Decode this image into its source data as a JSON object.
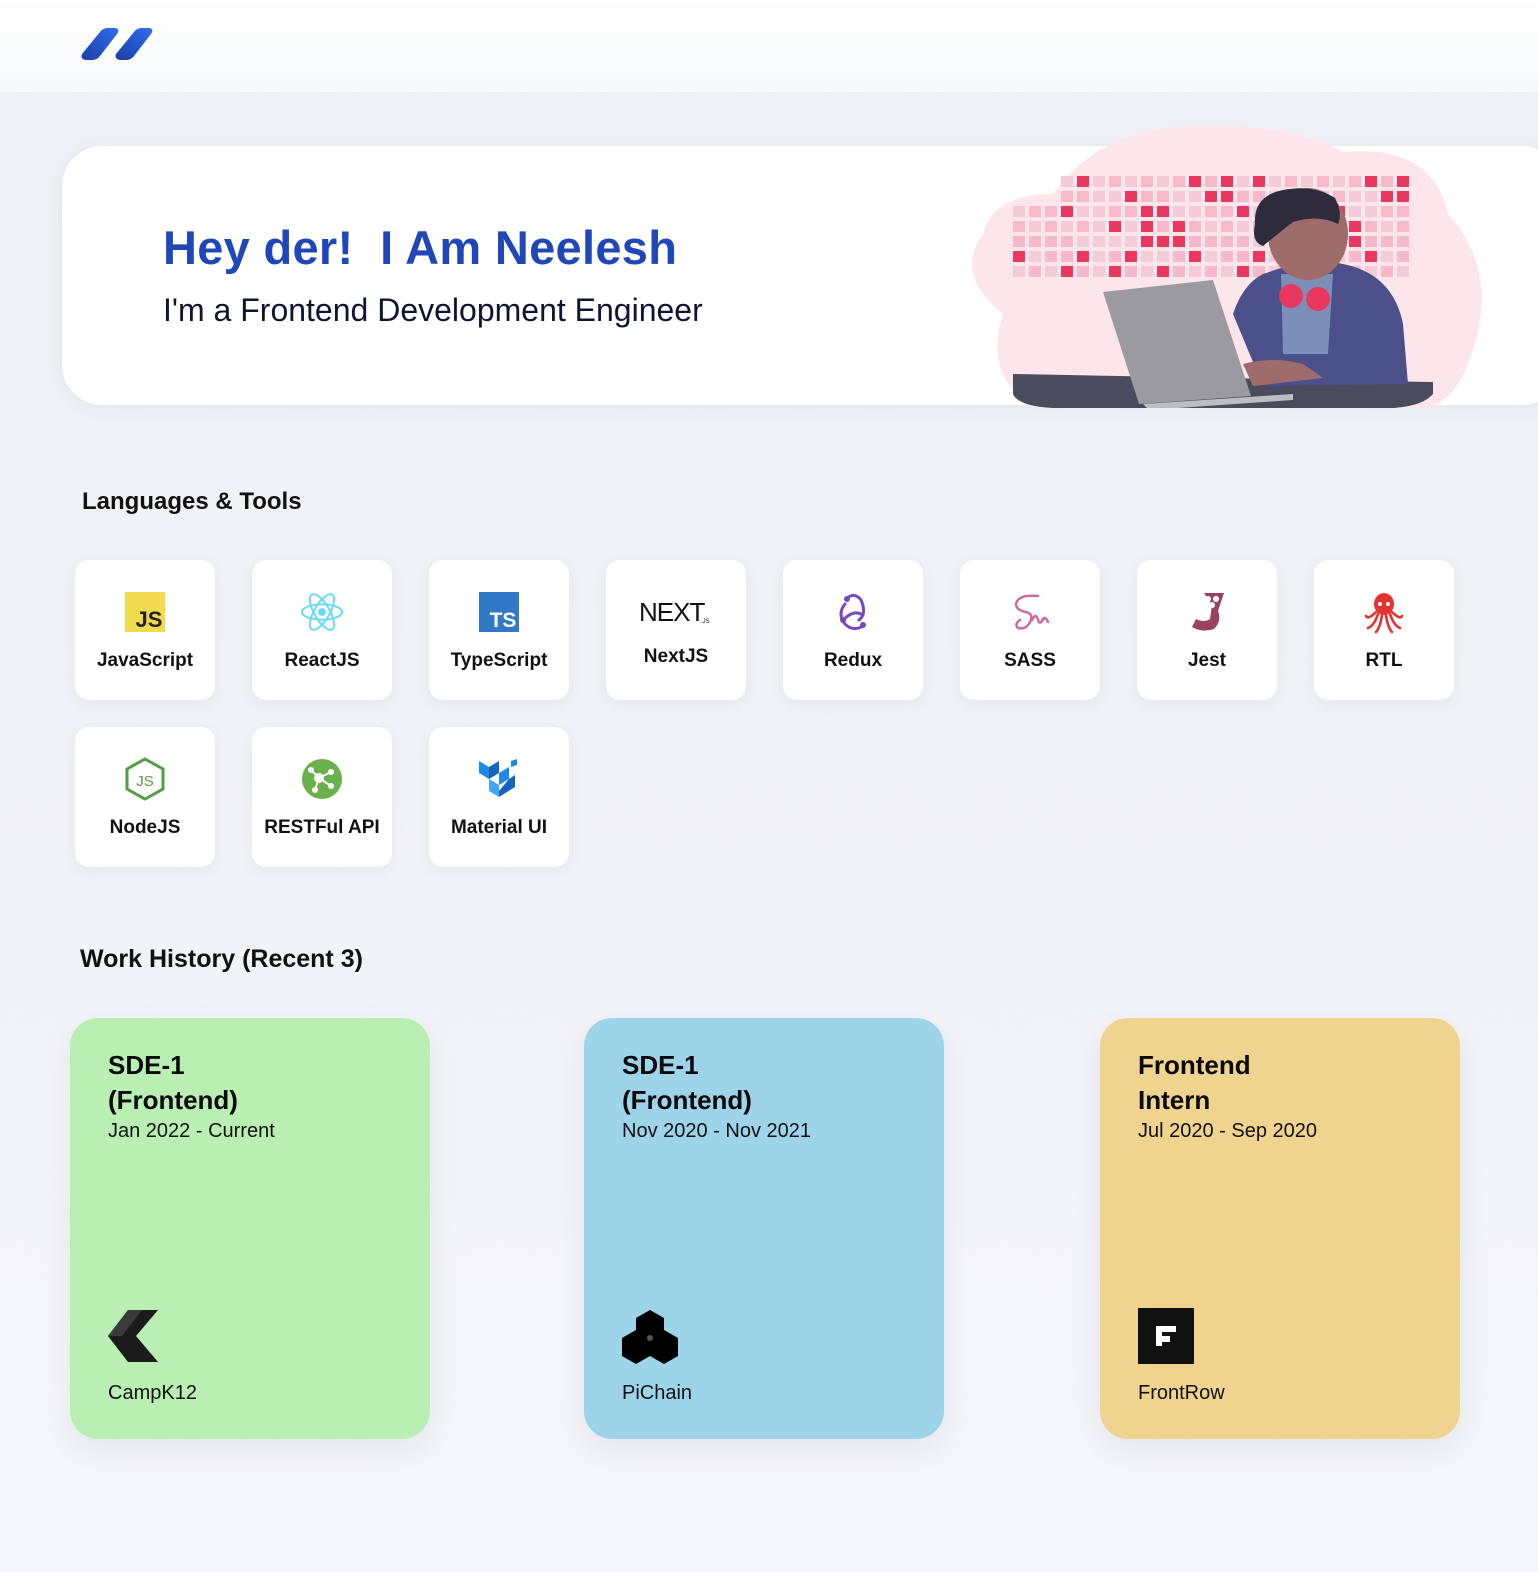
{
  "hero": {
    "title": "Hey der!  I Am Neelesh",
    "subtitle": "I'm a Frontend Development Engineer"
  },
  "skills": {
    "heading": "Languages & Tools",
    "items": [
      {
        "label": "JavaScript",
        "icon": "javascript-icon"
      },
      {
        "label": "ReactJS",
        "icon": "react-icon"
      },
      {
        "label": "TypeScript",
        "icon": "typescript-icon"
      },
      {
        "label": "NextJS",
        "icon": "nextjs-icon"
      },
      {
        "label": "Redux",
        "icon": "redux-icon"
      },
      {
        "label": "SASS",
        "icon": "sass-icon"
      },
      {
        "label": "Jest",
        "icon": "jest-icon"
      },
      {
        "label": "RTL",
        "icon": "octopus-icon"
      },
      {
        "label": "NodeJS",
        "icon": "nodejs-icon"
      },
      {
        "label": "RESTFul API",
        "icon": "api-icon"
      },
      {
        "label": "Material UI",
        "icon": "material-ui-icon"
      }
    ],
    "icon_text": {
      "js": "JS",
      "ts": "TS",
      "next": "NEXT",
      "next_sub": ".JS",
      "node": "JS"
    }
  },
  "work": {
    "heading": "Work History (Recent 3)",
    "jobs": [
      {
        "role": "SDE-1 (Frontend)",
        "dates": "Jan 2022 - Current",
        "company": "CampK12",
        "color": "#b9efb2",
        "logo": "campk12-logo"
      },
      {
        "role": "SDE-1 (Frontend)",
        "dates": "Nov 2020 - Nov 2021",
        "company": "PiChain",
        "color": "#9dd4ea",
        "logo": "pichain-logo"
      },
      {
        "role": "Frontend Intern",
        "dates": "Jul 2020 - Sep 2020",
        "company": "FrontRow",
        "color": "#f0d38f",
        "logo": "frontrow-logo"
      }
    ]
  },
  "colors": {
    "accent": "#1f47b8",
    "heading_dark": "#0f1433",
    "illustration_pink": "#e8385f"
  }
}
